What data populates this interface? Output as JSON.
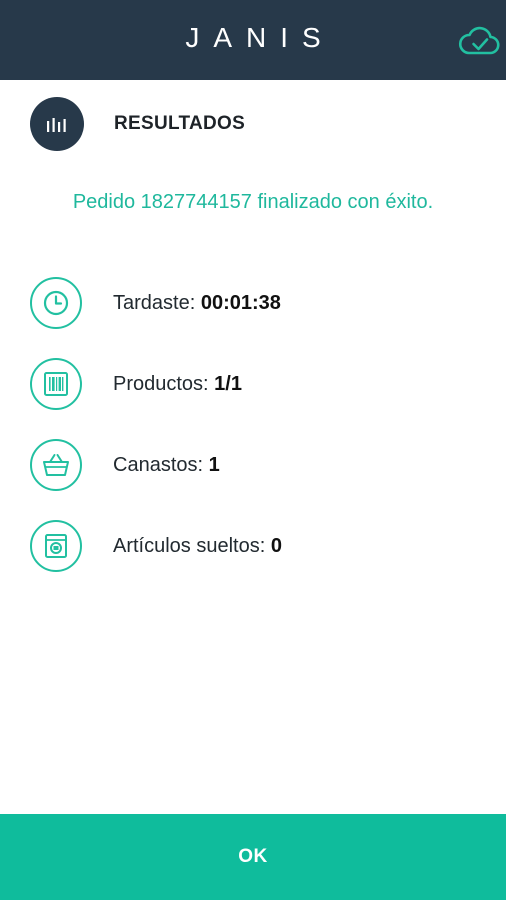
{
  "header": {
    "brand": "JANIS",
    "sync_icon": "cloud-check-icon"
  },
  "section": {
    "icon": "bar-chart-icon",
    "title": "RESULTADOS"
  },
  "message": "Pedido 1827744157 finalizado con éxito.",
  "stats": [
    {
      "icon": "clock-icon",
      "label": "Tardaste:",
      "value": "00:01:38"
    },
    {
      "icon": "barcode-icon",
      "label": "Productos:",
      "value": "1/1"
    },
    {
      "icon": "basket-icon",
      "label": "Canastos:",
      "value": "1"
    },
    {
      "icon": "loose-item-icon",
      "label": "Artículos sueltos:",
      "value": "0"
    }
  ],
  "footer": {
    "ok_label": "OK"
  },
  "colors": {
    "header_bg": "#27394a",
    "accent": "#22c0a1",
    "button_bg": "#0fbc9c",
    "message_text": "#1fb89d"
  }
}
